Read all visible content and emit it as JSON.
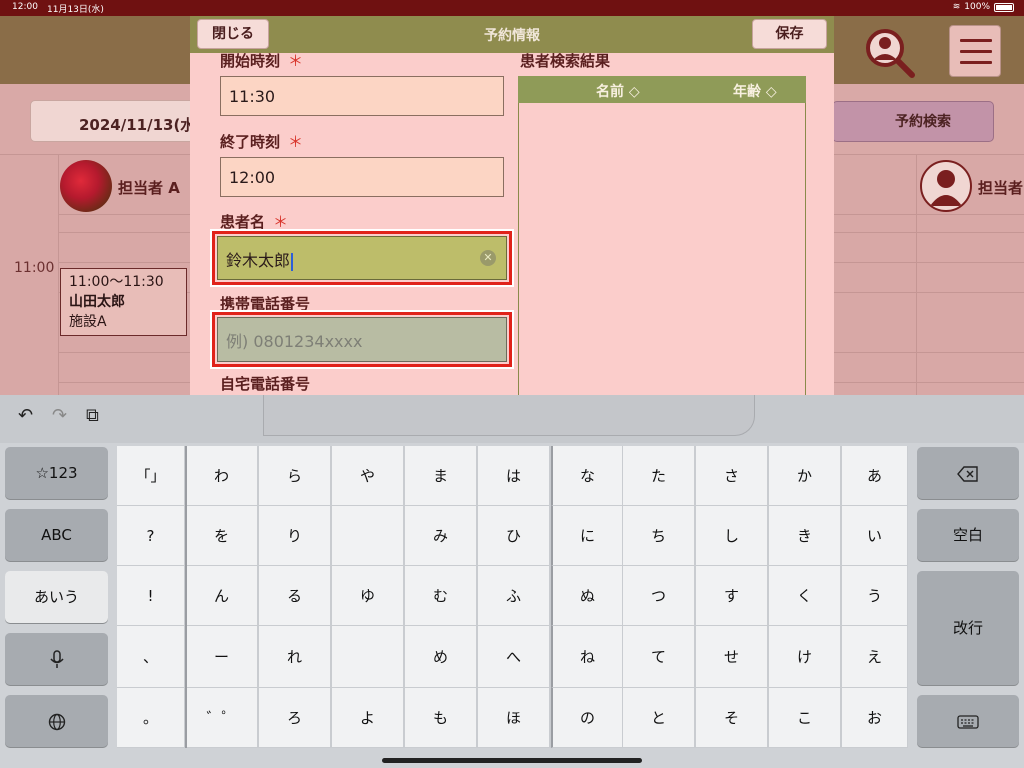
{
  "status_bar": {
    "time": "12:00",
    "date": "11月13日(水)",
    "battery": "100%"
  },
  "top_bar": {
    "date": "2024/11/13(水",
    "reservation_search": "予約検索"
  },
  "schedule": {
    "staff": [
      "担当者 A",
      "担当者"
    ],
    "time_label": "11:00",
    "appointment": {
      "time": "11:00～11:30",
      "patient": "山田太郎",
      "facility": "施設A"
    }
  },
  "modal": {
    "title": "予約情報",
    "close_label": "閉じる",
    "save_label": "保存",
    "required_mark": "＊",
    "fields": {
      "start_time": {
        "label": "開始時刻",
        "value": "11:30"
      },
      "end_time": {
        "label": "終了時刻",
        "value": "12:00"
      },
      "patient_name": {
        "label": "患者名",
        "value": "鈴木太郎"
      },
      "mobile_phone": {
        "label": "携帯電話番号",
        "placeholder": "例) 0801234xxxx"
      },
      "home_phone": {
        "label": "自宅電話番号"
      }
    },
    "results": {
      "title": "患者検索結果",
      "col_name": "名前 ◇",
      "col_age": "年齢 ◇"
    }
  },
  "keyboard": {
    "left_keys": [
      "☆123",
      "ABC",
      "あいう",
      "🎤",
      "🌐"
    ],
    "punct_keys": [
      "「」",
      "?",
      "!",
      "、",
      "。"
    ],
    "kana_grid": [
      [
        "わ",
        "ら",
        "や",
        "ま",
        "は",
        "な",
        "た",
        "さ",
        "か",
        "あ"
      ],
      [
        "を",
        "り",
        "",
        "み",
        "ひ",
        "に",
        "ち",
        "し",
        "き",
        "い"
      ],
      [
        "ん",
        "る",
        "ゆ",
        "む",
        "ふ",
        "ぬ",
        "つ",
        "す",
        "く",
        "う"
      ],
      [
        "ー",
        "れ",
        "",
        "め",
        "へ",
        "ね",
        "て",
        "せ",
        "け",
        "え"
      ],
      [
        "゛゜",
        "ろ",
        "よ",
        "も",
        "ほ",
        "の",
        "と",
        "そ",
        "こ",
        "お"
      ]
    ],
    "right_keys": {
      "delete": "⌫",
      "space": "空白",
      "enter": "改行",
      "dismiss": "⌨"
    }
  },
  "colors": {
    "accent": "#8f8c4e",
    "required": "#d8342b",
    "focus": "#e0221a",
    "brand_dark": "#6f1111"
  }
}
